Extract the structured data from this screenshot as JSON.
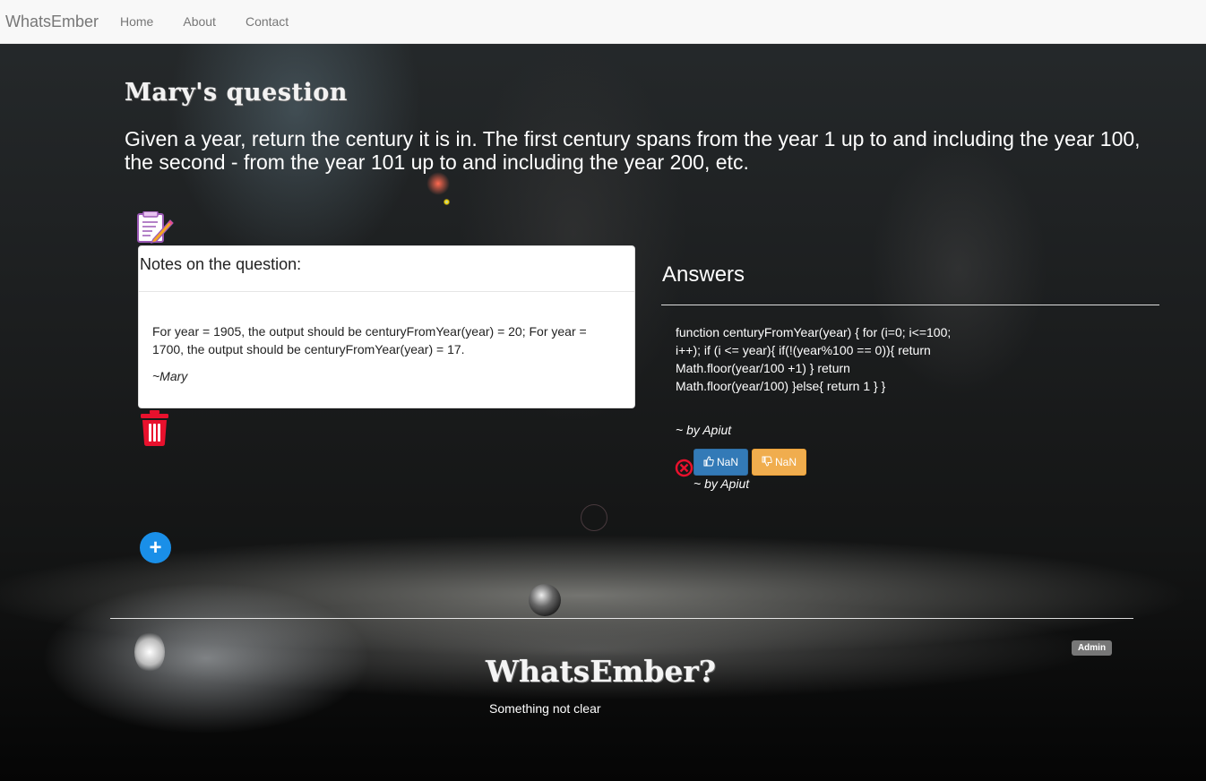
{
  "navbar": {
    "brand": "WhatsEmber",
    "links": [
      "Home",
      "About",
      "Contact"
    ]
  },
  "question": {
    "title": "Mary's question",
    "body": "Given a year, return the century it is in. The first century spans from the year 1 up to and including the year 100, the second - from the year 101 up to and including the year 200, etc."
  },
  "notes": {
    "heading": "Notes on the question:",
    "text": "For year = 1905, the output should be centuryFromYear(year) = 20; For year = 1700, the output should be centuryFromYear(year) = 17.",
    "signature": "~Mary",
    "add_symbol": "+"
  },
  "answers": {
    "heading": "Answers",
    "items": [
      {
        "text": "function centuryFromYear(year) { for (i=0; i<=100; i++); if (i <= year){ if(!(year%100 == 0)){ return Math.floor(year/100 +1) } return Math.floor(year/100) }else{ return 1 } }",
        "author": "~ by Apiut",
        "upvotes": "NaN",
        "downvotes": "NaN",
        "author_repeat": "~ by Apiut"
      }
    ]
  },
  "footer": {
    "admin_label": "Admin",
    "title": "WhatsEmber?",
    "subtitle": "Something not clear"
  },
  "colors": {
    "danger": "#e8112d",
    "primary": "#337ab7",
    "warning": "#f0ad4e",
    "add_button": "#1a8fe8"
  },
  "icons": [
    "notes-edit-icon",
    "trash-icon",
    "plus-icon",
    "delete-circle-icon",
    "thumbs-up-icon",
    "thumbs-down-icon"
  ]
}
